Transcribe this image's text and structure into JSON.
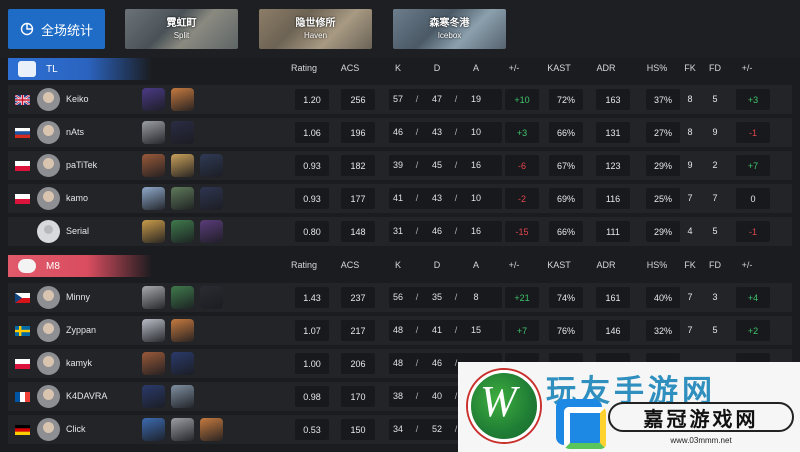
{
  "top": {
    "overall_label": "全场统计",
    "maps": [
      {
        "cn": "霓虹町",
        "en": "Split"
      },
      {
        "cn": "隐世修所",
        "en": "Haven"
      },
      {
        "cn": "森寒冬港",
        "en": "Icebox"
      }
    ]
  },
  "columns": [
    "Rating",
    "ACS",
    "K",
    "D",
    "A",
    "+/-",
    "KAST",
    "ADR",
    "HS%",
    "FK",
    "FD",
    "+/-"
  ],
  "teams": [
    {
      "name": "TL",
      "players": [
        {
          "name": "Keiko",
          "flag": "gb",
          "rating": "1.20",
          "acs": "256",
          "k": "57",
          "d": "47",
          "a": "19",
          "kd_diff": "+10",
          "kast": "72%",
          "adr": "163",
          "hs": "37%",
          "fk": "8",
          "fd": "5",
          "fk_diff": "+3",
          "agents": [
            "#4b3a86",
            "#c57a3f"
          ]
        },
        {
          "name": "nAts",
          "flag": "ru",
          "rating": "1.06",
          "acs": "196",
          "k": "46",
          "d": "43",
          "a": "10",
          "kd_diff": "+3",
          "kast": "66%",
          "adr": "131",
          "hs": "27%",
          "fk": "8",
          "fd": "9",
          "fk_diff": "-1",
          "agents": [
            "#9b9ea4",
            "#2a2c44"
          ]
        },
        {
          "name": "paTiTek",
          "flag": "pl",
          "rating": "0.93",
          "acs": "182",
          "k": "39",
          "d": "45",
          "a": "16",
          "kd_diff": "-6",
          "kast": "67%",
          "adr": "123",
          "hs": "29%",
          "fk": "9",
          "fd": "2",
          "fk_diff": "+7",
          "agents": [
            "#9a5a3a",
            "#c9a05a",
            "#2f3a55"
          ]
        },
        {
          "name": "kamo",
          "flag": "pl",
          "rating": "0.93",
          "acs": "177",
          "k": "41",
          "d": "43",
          "a": "10",
          "kd_diff": "-2",
          "kast": "69%",
          "adr": "116",
          "hs": "25%",
          "fk": "7",
          "fd": "7",
          "fk_diff": "0",
          "agents": [
            "#8fa9c9",
            "#5f7a5a",
            "#2e3550"
          ]
        },
        {
          "name": "Serial",
          "flag": "",
          "rating": "0.80",
          "acs": "148",
          "k": "31",
          "d": "46",
          "a": "16",
          "kd_diff": "-15",
          "kast": "66%",
          "adr": "111",
          "hs": "29%",
          "fk": "4",
          "fd": "5",
          "fk_diff": "-1",
          "agents": [
            "#c89b4a",
            "#3f7a4c",
            "#5a3c7a"
          ]
        }
      ]
    },
    {
      "name": "M8",
      "players": [
        {
          "name": "Minny",
          "flag": "cz",
          "rating": "1.43",
          "acs": "237",
          "k": "56",
          "d": "35",
          "a": "8",
          "kd_diff": "+21",
          "kast": "74%",
          "adr": "161",
          "hs": "40%",
          "fk": "7",
          "fd": "3",
          "fk_diff": "+4",
          "agents": [
            "#a7a9ad",
            "#3f7a4c",
            "#2a2c33"
          ]
        },
        {
          "name": "Zyppan",
          "flag": "se",
          "rating": "1.07",
          "acs": "217",
          "k": "48",
          "d": "41",
          "a": "15",
          "kd_diff": "+7",
          "kast": "76%",
          "adr": "146",
          "hs": "32%",
          "fk": "7",
          "fd": "5",
          "fk_diff": "+2",
          "agents": [
            "#b9bcc6",
            "#c57a3f"
          ]
        },
        {
          "name": "kamyk",
          "flag": "pl",
          "rating": "1.00",
          "acs": "206",
          "k": "48",
          "d": "46",
          "a": "",
          "kd_diff": "",
          "kast": "",
          "adr": "",
          "hs": "",
          "fk": "",
          "fd": "",
          "fk_diff": "",
          "agents": [
            "#9a5a3a",
            "#2a3a6a"
          ]
        },
        {
          "name": "K4DAVRA",
          "flag": "fr",
          "rating": "0.98",
          "acs": "170",
          "k": "38",
          "d": "40",
          "a": "",
          "kd_diff": "",
          "kast": "",
          "adr": "",
          "hs": "",
          "fk": "",
          "fd": "",
          "fk_diff": "",
          "agents": [
            "#2a3a6a",
            "#7f8fa0"
          ]
        },
        {
          "name": "Click",
          "flag": "de",
          "rating": "0.53",
          "acs": "150",
          "k": "34",
          "d": "52",
          "a": "",
          "kd_diff": "",
          "kast": "",
          "adr": "",
          "hs": "",
          "fk": "",
          "fd": "",
          "fk_diff": "",
          "agents": [
            "#3d6bb0",
            "#9b9ea4",
            "#c57a3f"
          ]
        }
      ]
    }
  ],
  "watermark": {
    "brand": "嘉冠游戏网",
    "url": "www.03mmm.net",
    "headline": "玩友手游网",
    "logo_letter": "W"
  },
  "colors": {
    "accent": "#1f6cc6",
    "tl": "#2b64c0",
    "m8": "#d94d5f",
    "positive": "#3ec46d",
    "negative": "#e2464d"
  }
}
